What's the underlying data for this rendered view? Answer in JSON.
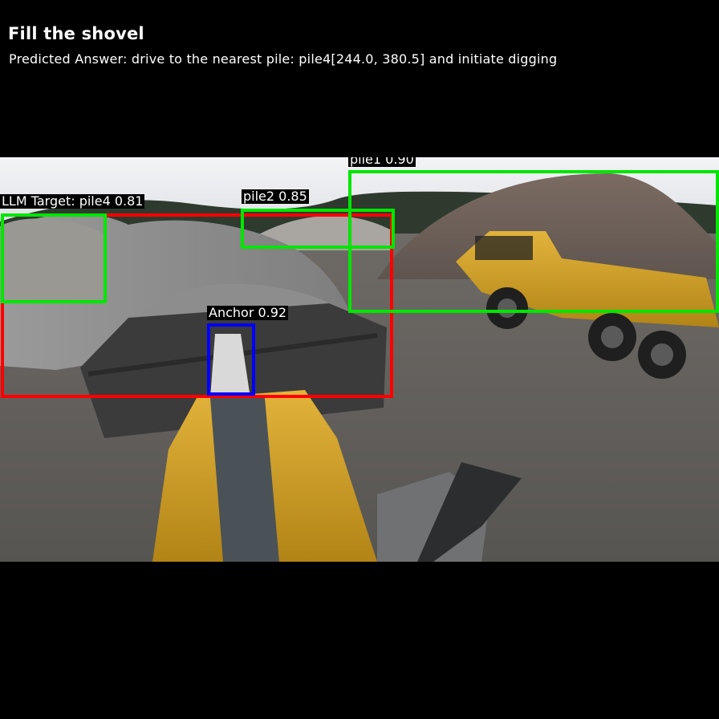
{
  "header": {
    "title": "Fill the shovel",
    "predicted_answer": "Predicted Answer: drive to the nearest pile: pile4[244.0, 380.5] and initiate digging"
  },
  "scene": {
    "description": "Wheel loader cab view of gravel piles with a dump truck"
  },
  "detections": [
    {
      "label": "pile1 0.90",
      "color": "#00e600"
    },
    {
      "label": "pile2 0.85",
      "color": "#00e600"
    },
    {
      "label": "LLM Target: pile4 0.81",
      "color": "#00e600"
    },
    {
      "label": "Anchor 0.92",
      "color": "#0000ff"
    }
  ],
  "target_box_color": "#ff0000",
  "colors": {
    "background": "#000000",
    "text": "#ffffff"
  }
}
